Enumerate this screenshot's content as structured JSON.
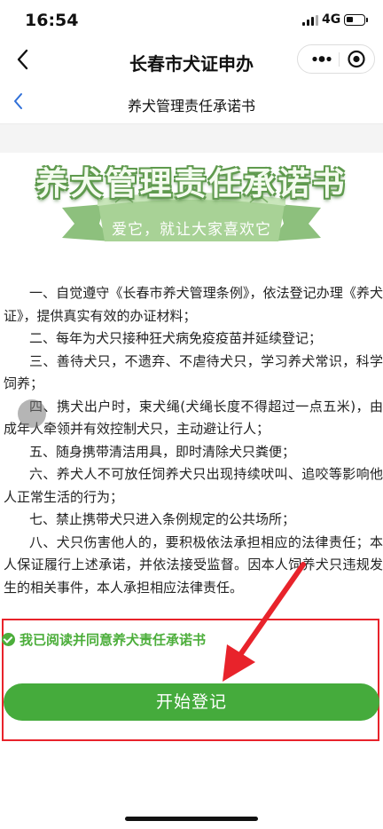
{
  "status": {
    "time": "16:54",
    "network": "4G"
  },
  "app": {
    "title": "长春市犬证申办"
  },
  "page": {
    "title": "养犬管理责任承诺书"
  },
  "banner": {
    "title": "养犬管理责任承诺书",
    "slogan": "爱它，就让大家喜欢它"
  },
  "terms": [
    "一、自觉遵守《长春市养犬管理条例》，依法登记办理《养犬证》，提供真实有效的办证材料；",
    "二、每年为犬只接种狂犬病免疫疫苗并延续登记；",
    "三、善待犬只，不遗弃、不虐待犬只，学习养犬常识，科学饲养；",
    "四、携犬出户时，束犬绳(犬绳长度不得超过一点五米)，由成年人牵领并有效控制犬只，主动避让行人；",
    "五、随身携带清洁用具，即时清除犬只粪便；",
    "六、养犬人不可放任饲养犬只出现持续吠叫、追咬等影响他人正常生活的行为；",
    "七、禁止携带犬只进入条例规定的公共场所；",
    "八、犬只伤害他人的，要积极依法承担相应的法律责任；本人保证履行上述承诺，并依法接受监督。因本人饲养犬只违规发生的相关事件，本人承担相应法律责任。"
  ],
  "agreement": {
    "label": "我已阅读并同意养犬责任承诺书",
    "checked": true
  },
  "start_button": {
    "label": "开始登记"
  },
  "colors": {
    "accent_green": "#45ab3c",
    "annotation_red": "#e8232b"
  },
  "icons": {
    "back": "chevron-left-icon",
    "more": "more-dots-icon",
    "close": "target-circle-icon",
    "check": "check-circle-icon"
  }
}
